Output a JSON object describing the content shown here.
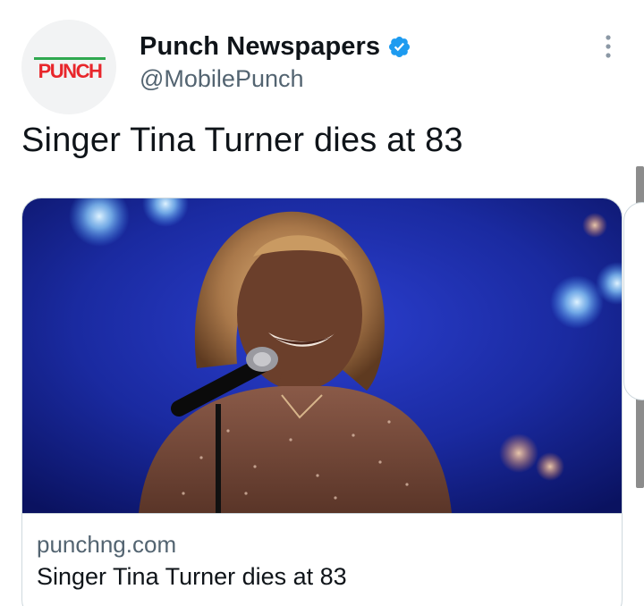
{
  "author": {
    "avatar_logo_text": "PUNCH",
    "display_name": "Punch Newspapers",
    "handle": "@MobilePunch",
    "verified": true
  },
  "tweet": {
    "text": "Singer Tina Turner dies at 83"
  },
  "card": {
    "image_alt": "Tina Turner singing into a microphone on stage",
    "domain": "punchng.com",
    "title": "Singer Tina Turner dies at 83"
  },
  "icons": {
    "more": "more-options-icon",
    "verified": "verified-badge-icon"
  },
  "colors": {
    "verified_blue": "#1d9bf0",
    "punch_red": "#e8262b",
    "punch_green": "#2fa84f",
    "secondary_text": "#536471",
    "stage_blue": "#1d2fa8"
  }
}
